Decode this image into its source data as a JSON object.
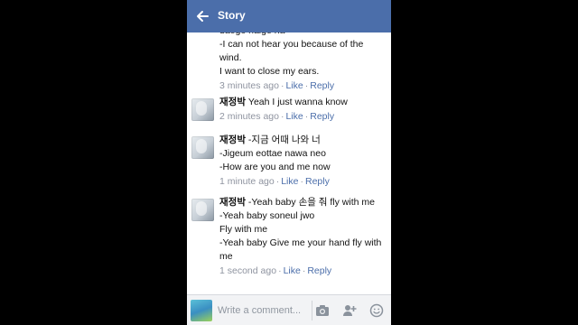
{
  "header": {
    "title": "Story"
  },
  "comments": [
    {
      "author": "",
      "text": "daego halge ha\n-I can not hear you because of the wind.\nI want to close my ears.",
      "time": "3 minutes ago",
      "like_label": "Like",
      "reply_label": "Reply"
    },
    {
      "author": "재정박",
      "text": "Yeah I just wanna know",
      "time": "2 minutes ago",
      "like_label": "Like",
      "reply_label": "Reply"
    },
    {
      "author": "재정박",
      "text": "-지금 어때 나와 너\n-Jigeum eottae nawa neo\n-How are you and me now",
      "time": "1 minute ago",
      "like_label": "Like",
      "reply_label": "Reply"
    },
    {
      "author": "재정박",
      "text": "-Yeah baby 손을 줘 fly with me\n-Yeah baby soneul jwo\nFly with me\n-Yeah baby Give me your hand fly with me",
      "time": "1 second ago",
      "like_label": "Like",
      "reply_label": "Reply"
    }
  ],
  "composer": {
    "placeholder": "Write a comment...",
    "icons": [
      "camera-icon",
      "tag-friend-icon",
      "emoji-icon"
    ]
  },
  "colors": {
    "header": "#4b6eaa",
    "link": "#4b6eaa",
    "meta": "#8f94a0"
  }
}
